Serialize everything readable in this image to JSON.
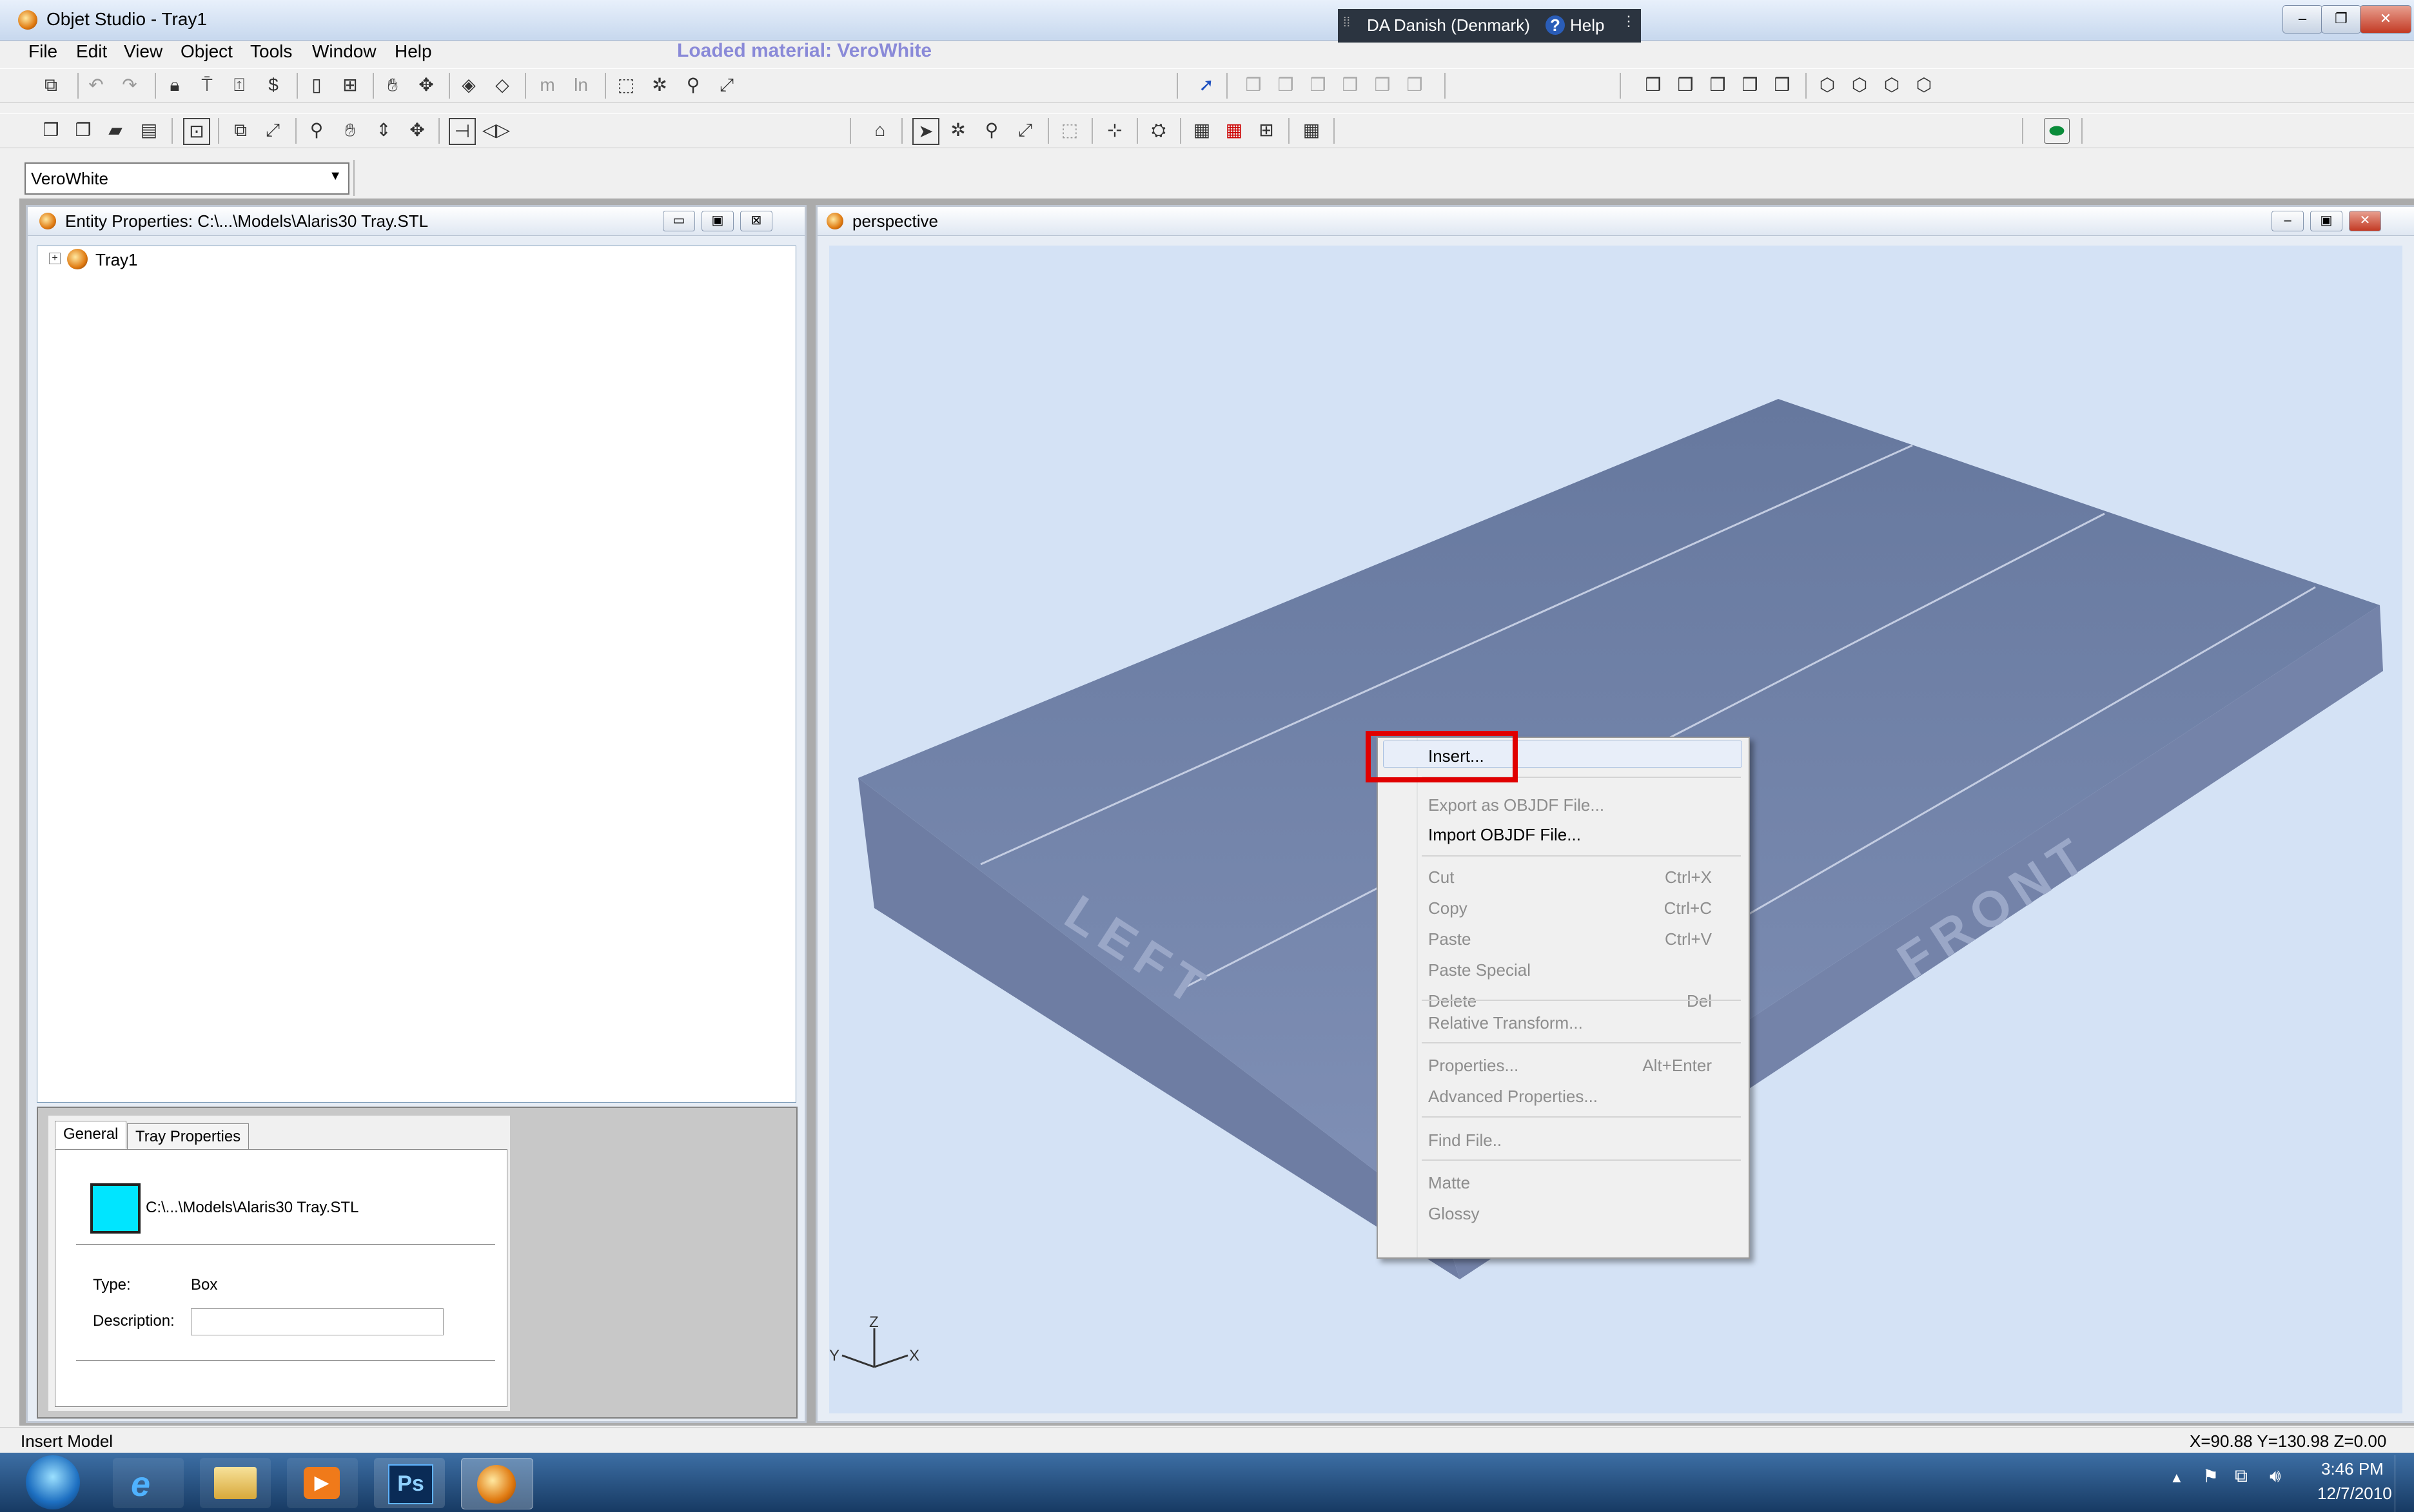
{
  "window": {
    "title": "Objet Studio - Tray1"
  },
  "language_bar": {
    "language": "DA Danish (Denmark)",
    "help": "Help"
  },
  "menu": [
    "File",
    "Edit",
    "View",
    "Object",
    "Tools",
    "Window",
    "Help"
  ],
  "loaded_material": "Loaded material: VeroWhite",
  "material_combo": {
    "value": "VeroWhite"
  },
  "entity_pane": {
    "title": "Entity Properties: C:\\...\\Models\\Alaris30 Tray.STL",
    "tree_root": "Tray1"
  },
  "properties": {
    "tabs": [
      "General",
      "Tray Properties"
    ],
    "file": "C:\\...\\Models\\Alaris30 Tray.STL",
    "type_label": "Type:",
    "type_value": "Box",
    "description_label": "Description:",
    "description_value": ""
  },
  "viewport": {
    "title": "perspective",
    "label_left": "LEFT",
    "label_front": "FRONT",
    "axis": {
      "z": "Z",
      "y": "Y",
      "x": "X"
    },
    "colors": {
      "background": "#d4e2f5",
      "tray": "#7886aa",
      "highlight": "#e00000"
    }
  },
  "context_menu": {
    "items": [
      {
        "label": "Insert...",
        "shortcut": "",
        "enabled": true,
        "highlighted": true
      },
      {
        "label": "Export as OBJDF File...",
        "shortcut": "",
        "enabled": false
      },
      {
        "label": "Import OBJDF File...",
        "shortcut": "",
        "enabled": true
      },
      {
        "label": "Cut",
        "shortcut": "Ctrl+X",
        "enabled": false
      },
      {
        "label": "Copy",
        "shortcut": "Ctrl+C",
        "enabled": false
      },
      {
        "label": "Paste",
        "shortcut": "Ctrl+V",
        "enabled": false
      },
      {
        "label": "Paste Special",
        "shortcut": "",
        "enabled": false
      },
      {
        "label": "Delete",
        "shortcut": "Del",
        "enabled": false
      },
      {
        "label": "Relative Transform...",
        "shortcut": "",
        "enabled": false
      },
      {
        "label": "Properties...",
        "shortcut": "Alt+Enter",
        "enabled": false
      },
      {
        "label": "Advanced Properties...",
        "shortcut": "",
        "enabled": false
      },
      {
        "label": "Find File..",
        "shortcut": "",
        "enabled": false
      },
      {
        "label": "Matte",
        "shortcut": "",
        "enabled": false
      },
      {
        "label": "Glossy",
        "shortcut": "",
        "enabled": false
      }
    ]
  },
  "status": {
    "left": "Insert Model",
    "coords": "X=90.88 Y=130.98 Z=0.00"
  },
  "taskbar": {
    "apps": [
      "start-orb",
      "internet-explorer",
      "file-explorer",
      "media-player",
      "photoshop",
      "objet-studio"
    ],
    "photoshop_label": "Ps",
    "time": "3:46 PM",
    "date": "12/7/2010"
  }
}
